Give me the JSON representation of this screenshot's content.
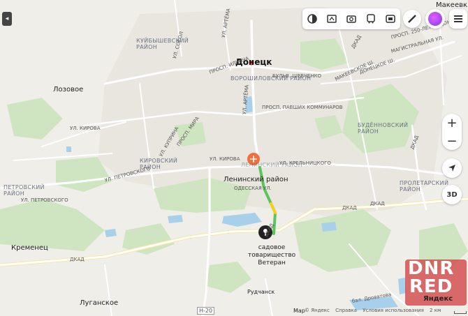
{
  "map": {
    "cities": {
      "donetsk": "Донецк",
      "makeevka": "Макеевк",
      "lozovoe": "Лозовое",
      "kremenets": "Кременец",
      "luganskoe": "Луганское",
      "rudchansk": "Рудчанск",
      "mar": "Мар"
    },
    "districts": {
      "kuibyshev": "КУЙБЫШЕВСКИЙ РАЙОН",
      "voroshilov": "ВОРОШИЛОВСКИЙ РАЙОН",
      "kirov": "КИРОВСКИЙ РАЙОН",
      "petrov": "ПЕТРОВСКИЙ РАЙОН",
      "budennov": "БУДЁННОВСКИЙ РАЙОН",
      "proletar": "ПРОЛЕТАРСКИЙ РАЙОН",
      "leninsky_dim": "ЛЕНИНСКИЙ РАЙОН"
    },
    "streets": {
      "artema1": "УЛ. АРТЁМА",
      "artema2": "УЛ. АРТЁМА",
      "sokol": "УЛ. СОКОЛ",
      "ilyicha": "ПРОСП. ИЛЬИЧА",
      "shevchenko": "БУЛЬВ. ШЕВЧЕНКО",
      "pavshih": "ПРОСП. ПАВШИХ КОММУНАРОВ",
      "makeev": "МАКЕЕВСКОЕ Ш.",
      "donetskoe": "ДОНЕЦКОЕ Ш.",
      "kirova": "УЛ. КИРОВА",
      "kirova2": "УЛ. КИРОВА",
      "petrovskogo": "УЛ. ПЕТРОВСКОГО",
      "petrovskogo2": "УЛ. ПЕТРОВСКОГО",
      "krelnik": "УЛ. КРЕЛЬНИЦКОГО",
      "odessk": "ОДЕССКАЯ УЛ.",
      "dkad1": "ДКАД",
      "dkad2": "ДКАД",
      "dkad3": "ДКАД",
      "dkad4": "ДКАД",
      "dkad5": "ДКАД",
      "dkad6": "ДКАД",
      "magistral": "МАГИСТРАЛЬНАЯ УЛ.",
      "250let": "ПРОСП. 250-ЛЕТИЯ ДОНБАССА",
      "kuprina": "УЛ. КУПРИНА",
      "mir": "ПРОСП. МИРА",
      "h20": "Н-20",
      "drovatova": "бал. Дроватова",
      "2km": "2 км"
    },
    "marker": {
      "label_line1": "садовое",
      "label_line2": "товарищество",
      "label_line3": "Ветеран"
    },
    "leninsky_label": "Ленинский район"
  },
  "controls": {
    "zoom_in": "+",
    "zoom_out": "−",
    "three_d": "3D",
    "collapse": "◂"
  },
  "footer": {
    "copyright": "© Яндекс",
    "help": "Справка",
    "terms": "Условия использования",
    "scale": "2 км"
  },
  "watermark": {
    "line1": "DNR",
    "line2": "RED",
    "brand": "Яндекс"
  },
  "colors": {
    "route_main": "#5cc45c",
    "route_yellow": "#f3d21c",
    "marker_orange": "#f26f3c",
    "pin_dark": "#222222",
    "park": "#cfe5c2",
    "water": "#a9d0ea",
    "road": "#ffffff",
    "highway": "#f8e49e"
  }
}
